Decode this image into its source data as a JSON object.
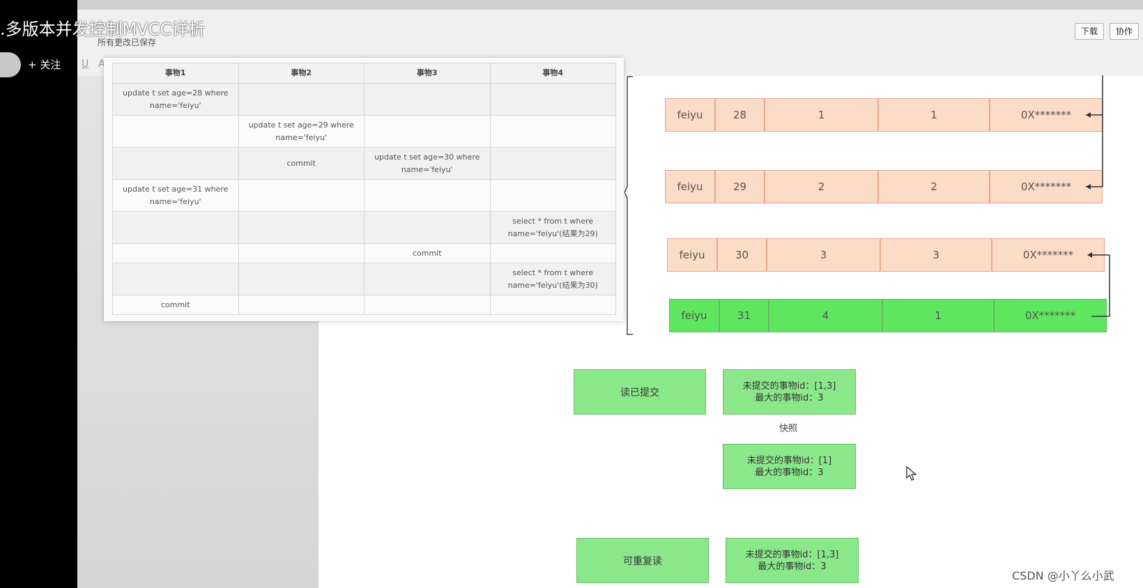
{
  "video": {
    "title": ".多版本并发控制MVCC详析",
    "follow": "+ 关注"
  },
  "app": {
    "save_status": "所有更改已保存",
    "download": "下载",
    "collab": "协作",
    "toolbar_underline": "U",
    "toolbar_a": "A"
  },
  "txn_table": {
    "headers": [
      "事物1",
      "事物2",
      "事物3",
      "事物4"
    ],
    "rows": [
      [
        "update t set age=28 where name='feiyu'",
        "",
        "",
        ""
      ],
      [
        "",
        "update t set age=29 where name='feiyu'",
        "",
        ""
      ],
      [
        "",
        "commit",
        "update t set age=30 where name='feiyu'",
        ""
      ],
      [
        "update t set age=31 where name='feiyu'",
        "",
        "",
        ""
      ],
      [
        "",
        "",
        "",
        "select * from t where name='feiyu'(结果为29)"
      ],
      [
        "",
        "",
        "commit",
        ""
      ],
      [
        "",
        "",
        "",
        "select * from t where name='feiyu'(结果为30)"
      ],
      [
        "commit",
        "",
        "",
        ""
      ]
    ]
  },
  "records": [
    {
      "name": "feiyu",
      "age": "28",
      "trx": "1",
      "roll": "1",
      "ptr": "0X*******"
    },
    {
      "name": "feiyu",
      "age": "29",
      "trx": "2",
      "roll": "2",
      "ptr": "0X*******"
    },
    {
      "name": "feiyu",
      "age": "30",
      "trx": "3",
      "roll": "3",
      "ptr": "0X*******"
    },
    {
      "name": "feiyu",
      "age": "31",
      "trx": "4",
      "roll": "1",
      "ptr": "0X*******"
    }
  ],
  "isolation": {
    "read_committed": "读已提交",
    "repeatable_read": "可重复读",
    "snapshot_label": "快照",
    "rc_snap1_line1": "未提交的事物id：[1,3]",
    "rc_snap1_line2": "最大的事物id：3",
    "rc_snap2_line1": "未提交的事物id：[1]",
    "rc_snap2_line2": "最大的事物id：3",
    "rr_snap_line1": "未提交的事物id：[1,3]",
    "rr_snap_line2": "最大的事物id：3"
  },
  "watermark": "CSDN @小丫么小武",
  "colors": {
    "record_old": "#fbdcc7",
    "record_new": "#5ee65e",
    "green_box": "#8ae88a"
  }
}
